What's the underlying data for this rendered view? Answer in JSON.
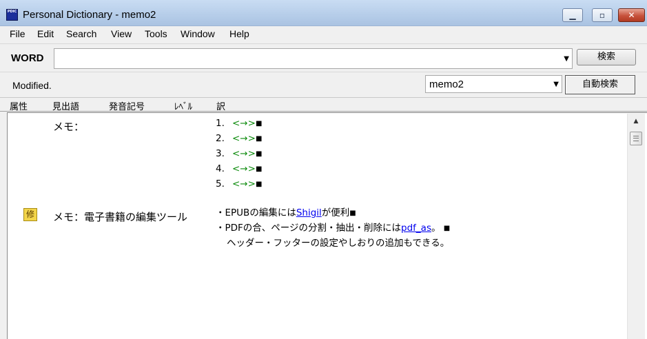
{
  "window": {
    "title": "Personal Dictionary - memo2",
    "icon_text": "PDIC",
    "controls": [
      "minimize-icon",
      "maximize-icon",
      "close-icon"
    ]
  },
  "menu": [
    "File",
    "Edit",
    "Search",
    "View",
    "Tools",
    "Window",
    "Help"
  ],
  "word_bar": {
    "label": "WORD",
    "value": "",
    "search_button": "検索"
  },
  "status_row": {
    "status": "Modified.",
    "dictionary": "memo2",
    "auto_search_button": "自動検索"
  },
  "columns": [
    "属性",
    "見出語",
    "発音記号",
    "ﾚﾍﾞﾙ",
    "訳"
  ],
  "entries": [
    {
      "headword": "メモ：",
      "badge": "",
      "lines": [
        {
          "num": "1.",
          "text": "<→>"
        },
        {
          "num": "2.",
          "text": "<→>"
        },
        {
          "num": "3.",
          "text": "<→>"
        },
        {
          "num": "4.",
          "text": "<→>"
        },
        {
          "num": "5.",
          "text": "<→>"
        }
      ],
      "end_mark": "■"
    },
    {
      "headword": "メモ：電子書籍の編集ツール",
      "badge": "修",
      "line1": {
        "prefix": "・EPUBの編集には",
        "link": "Shigil",
        "suffix": "が便利",
        "end_mark": "■"
      },
      "line2": {
        "prefix": "・PDFの合、ページの分割・抽出・削除には",
        "link": "pdf_as",
        "suffix": "。",
        "end_mark": "■"
      },
      "line3": {
        "text": "ヘッダー・フッターの設定やしおりの追加もできる。"
      }
    }
  ]
}
